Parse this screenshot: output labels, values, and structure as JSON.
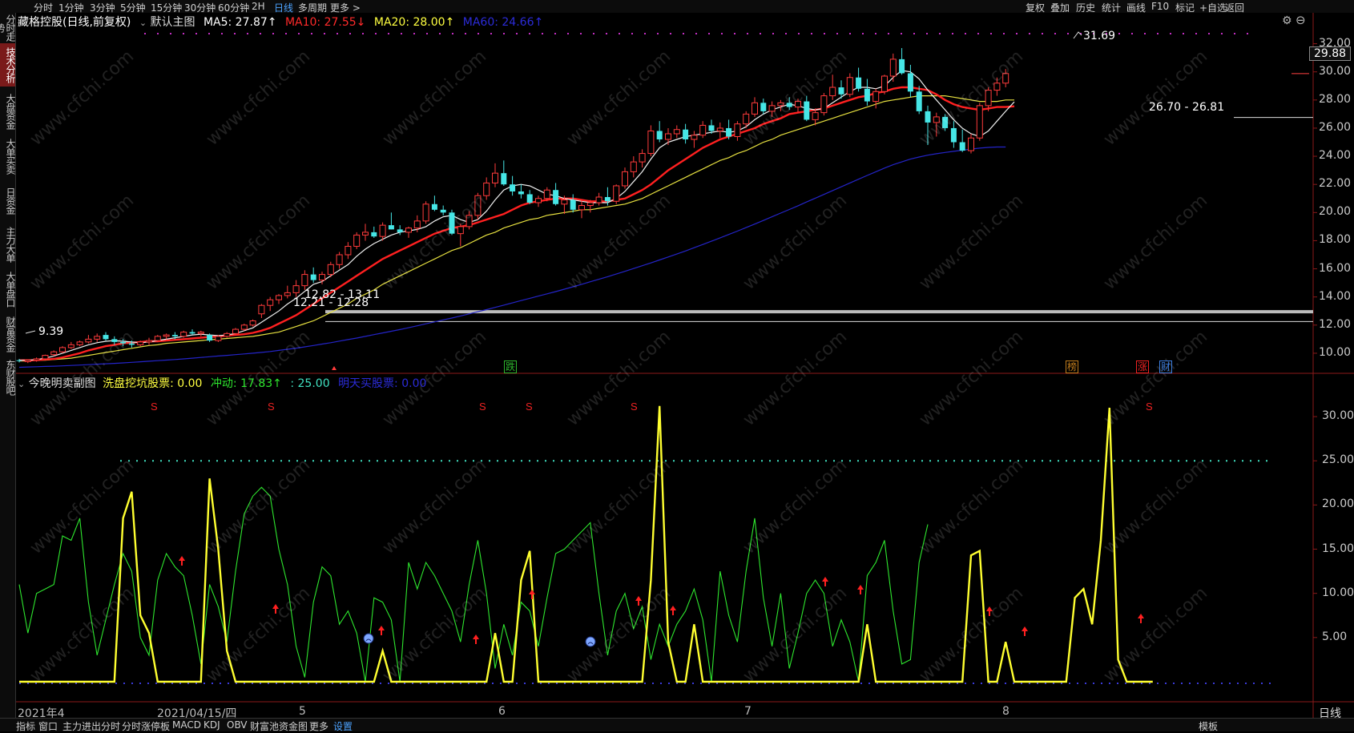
{
  "topbar": {
    "timeframes": [
      "分时",
      "1分钟",
      "3分钟",
      "5分钟",
      "15分钟",
      "30分钟",
      "60分钟",
      "2H",
      "日线",
      "多周期",
      "更多 >"
    ],
    "active_timeframe": "日线",
    "right_tools": [
      "复权",
      "叠加",
      "历史",
      "统计",
      "画线",
      "F10",
      "标记",
      "+自选",
      "返回"
    ]
  },
  "sidebar": {
    "items": [
      "分时走势",
      "技术分析",
      "大盘资金",
      "大单买卖",
      "日资金",
      "主力大单",
      "大单盘口",
      "财富资金",
      "东财股吧"
    ],
    "active": "技术分析"
  },
  "main_legend": {
    "title": "藏格控股(日线,前复权)",
    "indicator": "默认主图",
    "ma5": "MA5: 27.87↑",
    "ma10": "MA10: 27.55↓",
    "ma20": "MA20: 28.00↑",
    "ma60": "MA60: 24.66↑"
  },
  "sub_legend": {
    "title": "今晚明卖副图",
    "a": "洗盘挖坑股票: 0.00",
    "b": "冲动: 17.83↑",
    "c": ": 25.00",
    "d": "明天买股票: 0.00"
  },
  "price_axis": [
    "32.00",
    "30.00",
    "28.00",
    "26.00",
    "24.00",
    "22.00",
    "20.00",
    "18.00",
    "16.00",
    "14.00",
    "12.00",
    "10.00"
  ],
  "sub_axis": [
    "30.00",
    "25.00",
    "20.00",
    "15.00",
    "10.00",
    "5.00"
  ],
  "current_price": "29.88",
  "annotations": {
    "high": "31.69",
    "range_right": "26.70 - 26.81",
    "range_mid": "12.82 - 13.11",
    "range_low": "12.21 - 12.28",
    "low": "9.39"
  },
  "event_tags": [
    {
      "text": "跌",
      "color": "#2db52d"
    },
    {
      "text": "榜",
      "color": "#c07c1c"
    },
    {
      "text": "涨",
      "color": "#e22"
    },
    {
      "text": "财",
      "color": "#3c7ee0"
    }
  ],
  "x_axis": [
    "2021年4",
    "2021/04/15/四",
    "5",
    "6",
    "7",
    "8"
  ],
  "sub_axis_right": "日线",
  "bottombar": {
    "tabs": [
      "指标",
      "窗口",
      "主力进出分时",
      "分时涨停板",
      "MACD",
      "KDJ",
      "OBV",
      "财富池资金图",
      "更多",
      "设置"
    ],
    "active": "设置",
    "right": "模板"
  },
  "watermark": "www.cfchi.com",
  "chart_data": {
    "type": "line",
    "price_ylim": [
      8.8,
      33.4
    ],
    "sub_ylim": [
      -1,
      32
    ],
    "candles_ohlc": [
      [
        9.5,
        9.6,
        9.35,
        9.45
      ],
      [
        9.4,
        9.55,
        9.3,
        9.5
      ],
      [
        9.5,
        9.7,
        9.4,
        9.6
      ],
      [
        9.6,
        9.9,
        9.5,
        9.85
      ],
      [
        9.9,
        10.2,
        9.8,
        10.1
      ],
      [
        10.1,
        10.5,
        10.0,
        10.4
      ],
      [
        10.4,
        10.8,
        10.3,
        10.6
      ],
      [
        10.6,
        10.9,
        10.5,
        10.8
      ],
      [
        10.8,
        11.3,
        10.7,
        11.0
      ],
      [
        11.0,
        11.4,
        10.8,
        11.2
      ],
      [
        11.3,
        11.5,
        10.9,
        11.0
      ],
      [
        11.0,
        11.2,
        10.6,
        10.8
      ],
      [
        10.8,
        11.0,
        10.5,
        10.7
      ],
      [
        10.7,
        10.9,
        10.4,
        10.6
      ],
      [
        10.6,
        10.9,
        10.5,
        10.8
      ],
      [
        10.8,
        11.1,
        10.6,
        10.9
      ],
      [
        10.9,
        11.3,
        10.8,
        11.2
      ],
      [
        11.2,
        11.4,
        11.0,
        11.3
      ],
      [
        11.3,
        11.5,
        11.0,
        11.2
      ],
      [
        11.2,
        11.6,
        11.1,
        11.5
      ],
      [
        11.5,
        11.7,
        11.3,
        11.4
      ],
      [
        11.4,
        11.6,
        11.2,
        11.5
      ],
      [
        11.3,
        11.4,
        10.8,
        10.9
      ],
      [
        10.9,
        11.3,
        10.8,
        11.2
      ],
      [
        11.2,
        11.5,
        11.1,
        11.4
      ],
      [
        11.4,
        11.8,
        11.3,
        11.7
      ],
      [
        11.7,
        12.1,
        11.6,
        12.0
      ],
      [
        12.0,
        12.4,
        11.9,
        12.3
      ],
      [
        12.8,
        13.5,
        12.5,
        13.4
      ],
      [
        13.4,
        14.0,
        13.0,
        13.8
      ],
      [
        13.8,
        14.2,
        13.5,
        14.1
      ],
      [
        14.1,
        14.8,
        13.9,
        14.3
      ],
      [
        14.3,
        15.2,
        14.0,
        14.8
      ],
      [
        14.8,
        15.9,
        14.5,
        15.6
      ],
      [
        15.6,
        16.1,
        15.0,
        15.2
      ],
      [
        15.2,
        15.8,
        14.9,
        15.6
      ],
      [
        15.6,
        16.5,
        15.4,
        16.3
      ],
      [
        16.3,
        17.2,
        16.0,
        17.0
      ],
      [
        17.0,
        17.9,
        16.7,
        17.6
      ],
      [
        17.6,
        18.6,
        17.4,
        18.4
      ],
      [
        18.4,
        19.2,
        18.0,
        18.6
      ],
      [
        18.6,
        19.0,
        18.2,
        18.3
      ],
      [
        18.3,
        19.3,
        18.0,
        19.1
      ],
      [
        19.1,
        20.0,
        18.8,
        18.8
      ],
      [
        18.8,
        19.1,
        18.4,
        18.6
      ],
      [
        18.6,
        19.0,
        18.2,
        18.9
      ],
      [
        18.9,
        19.8,
        18.6,
        19.4
      ],
      [
        19.4,
        20.8,
        19.2,
        20.6
      ],
      [
        20.6,
        21.2,
        20.1,
        20.2
      ],
      [
        20.2,
        20.5,
        19.8,
        20.0
      ],
      [
        20.0,
        20.2,
        18.4,
        18.5
      ],
      [
        18.5,
        19.2,
        17.6,
        19.0
      ],
      [
        19.0,
        20.1,
        18.8,
        19.8
      ],
      [
        19.8,
        21.4,
        19.5,
        21.2
      ],
      [
        21.2,
        22.5,
        20.9,
        22.1
      ],
      [
        22.1,
        23.5,
        21.8,
        22.8
      ],
      [
        22.8,
        23.7,
        21.9,
        22.0
      ],
      [
        22.0,
        22.6,
        21.2,
        21.5
      ],
      [
        21.5,
        22.0,
        21.0,
        21.3
      ],
      [
        21.3,
        21.6,
        20.6,
        20.7
      ],
      [
        20.7,
        21.2,
        20.4,
        21.0
      ],
      [
        21.0,
        21.8,
        20.8,
        21.6
      ],
      [
        21.6,
        22.1,
        20.5,
        20.6
      ],
      [
        20.6,
        21.2,
        19.9,
        20.9
      ],
      [
        20.9,
        21.3,
        20.0,
        20.2
      ],
      [
        20.2,
        20.9,
        19.6,
        20.5
      ],
      [
        20.5,
        20.9,
        20.0,
        20.7
      ],
      [
        20.7,
        21.4,
        20.5,
        21.1
      ],
      [
        21.1,
        21.8,
        20.5,
        20.8
      ],
      [
        20.8,
        22.0,
        20.6,
        21.9
      ],
      [
        21.9,
        23.2,
        21.7,
        22.9
      ],
      [
        22.9,
        24.0,
        22.5,
        23.6
      ],
      [
        23.6,
        24.5,
        23.2,
        24.2
      ],
      [
        24.2,
        26.2,
        24.0,
        25.8
      ],
      [
        25.8,
        26.5,
        25.0,
        25.2
      ],
      [
        25.2,
        26.0,
        24.8,
        25.6
      ],
      [
        25.6,
        26.2,
        25.3,
        25.9
      ],
      [
        25.9,
        26.3,
        24.9,
        25.2
      ],
      [
        25.2,
        25.8,
        24.6,
        25.5
      ],
      [
        25.5,
        26.5,
        25.3,
        26.2
      ],
      [
        26.2,
        26.6,
        25.6,
        25.8
      ],
      [
        25.8,
        26.4,
        25.3,
        26.0
      ],
      [
        26.0,
        26.6,
        25.2,
        25.4
      ],
      [
        25.4,
        26.5,
        25.1,
        26.3
      ],
      [
        26.3,
        27.2,
        26.0,
        27.0
      ],
      [
        27.0,
        28.2,
        26.8,
        27.8
      ],
      [
        27.8,
        28.1,
        27.0,
        27.2
      ],
      [
        27.2,
        27.9,
        26.8,
        27.6
      ],
      [
        27.6,
        28.0,
        27.2,
        27.8
      ],
      [
        27.8,
        28.2,
        27.3,
        27.5
      ],
      [
        27.5,
        28.1,
        27.1,
        27.9
      ],
      [
        27.9,
        28.3,
        26.5,
        26.6
      ],
      [
        26.6,
        27.4,
        26.2,
        27.1
      ],
      [
        27.1,
        28.5,
        26.9,
        28.3
      ],
      [
        28.3,
        29.8,
        28.0,
        28.9
      ],
      [
        28.9,
        29.4,
        28.1,
        28.4
      ],
      [
        28.4,
        29.9,
        28.2,
        29.6
      ],
      [
        29.6,
        30.3,
        28.6,
        28.8
      ],
      [
        28.8,
        29.5,
        27.6,
        27.9
      ],
      [
        27.9,
        28.8,
        27.4,
        28.6
      ],
      [
        28.6,
        29.8,
        28.4,
        29.7
      ],
      [
        29.7,
        31.3,
        29.3,
        30.9
      ],
      [
        30.9,
        31.69,
        29.8,
        29.9
      ],
      [
        29.9,
        30.5,
        28.2,
        28.6
      ],
      [
        28.6,
        29.0,
        27.0,
        27.2
      ],
      [
        27.2,
        27.6,
        24.8,
        26.4
      ],
      [
        26.4,
        27.1,
        25.4,
        26.8
      ],
      [
        26.8,
        27.0,
        25.8,
        26.0
      ],
      [
        26.0,
        26.5,
        24.6,
        25.0
      ],
      [
        25.0,
        25.9,
        24.3,
        24.4
      ],
      [
        24.4,
        25.6,
        24.2,
        25.3
      ],
      [
        25.3,
        27.8,
        25.1,
        27.6
      ],
      [
        27.6,
        28.9,
        27.2,
        28.7
      ],
      [
        28.7,
        29.6,
        28.3,
        29.2
      ],
      [
        29.2,
        30.2,
        28.9,
        29.88
      ]
    ],
    "yellow_series": [
      0,
      0,
      0,
      0,
      0,
      0,
      0,
      0,
      0,
      0,
      0,
      0,
      18.5,
      21.5,
      7.5,
      5.5,
      0,
      0,
      0,
      0,
      0,
      0,
      23,
      15,
      3.5,
      0,
      0,
      0,
      0,
      0,
      0,
      0,
      0,
      0,
      0,
      0,
      0,
      0,
      0,
      0,
      0,
      0,
      3.5,
      0,
      0,
      0,
      0,
      0,
      0,
      0,
      0,
      0,
      0,
      0,
      0,
      5.5,
      0,
      0,
      11.5,
      14.8,
      0,
      0,
      0,
      0,
      0,
      0,
      0,
      0,
      0,
      0,
      0,
      0,
      0,
      11.5,
      31.2,
      4.5,
      0,
      0,
      6.5,
      0,
      0,
      0,
      0,
      0,
      0,
      0,
      0,
      0,
      0,
      0,
      0,
      0,
      0,
      0,
      0,
      0,
      0,
      0,
      6.5,
      0,
      0,
      0,
      0,
      0,
      0,
      0,
      0,
      0,
      0,
      0,
      14.3,
      14.8,
      0,
      0,
      4.5,
      0,
      0,
      0,
      0,
      0,
      0,
      0,
      9.5,
      10.5,
      6.5,
      16,
      31,
      2.5,
      0,
      0,
      0,
      0
    ],
    "green_series": [
      11,
      5.5,
      10,
      10.5,
      11,
      16.5,
      16,
      18.5,
      9,
      3,
      7,
      11,
      14.5,
      12.5,
      5,
      3,
      11.5,
      14.5,
      13,
      12,
      7.5,
      2,
      11,
      8.5,
      4.5,
      12.5,
      19,
      21,
      22,
      21,
      15,
      11,
      4,
      0.5,
      9,
      13,
      12,
      6.5,
      8,
      5.5,
      0,
      9.5,
      9,
      7,
      0,
      13.5,
      10.5,
      13.5,
      12,
      10,
      8,
      4.5,
      11,
      16,
      10,
      1.5,
      6.5,
      3,
      9,
      8,
      4,
      9.5,
      14.5,
      15,
      16,
      17,
      18,
      10,
      3,
      8,
      10,
      6,
      8.5,
      2.5,
      6.5,
      4,
      6.5,
      8,
      10.5,
      7,
      0,
      12.5,
      7.5,
      4.5,
      12.5,
      18.5,
      9.5,
      4,
      10,
      1.5,
      5.5,
      10,
      11.5,
      10,
      4,
      7,
      4.5,
      0,
      12,
      13.5,
      16,
      8,
      2,
      2.5,
      13.5,
      17.8
    ],
    "ma5": [
      9.5,
      9.5,
      9.55,
      9.65,
      9.8,
      10.0,
      10.2,
      10.4,
      10.6,
      10.75,
      10.85,
      10.9,
      10.85,
      10.8,
      10.75,
      10.8,
      10.9,
      11.0,
      11.1,
      11.2,
      11.3,
      11.35,
      11.3,
      11.25,
      11.3,
      11.4,
      11.6,
      11.8,
      12.2,
      12.6,
      13.0,
      13.5,
      13.9,
      14.4,
      14.9,
      15.1,
      15.5,
      15.9,
      16.3,
      16.9,
      17.4,
      17.8,
      18.1,
      18.4,
      18.6,
      18.7,
      18.8,
      19.0,
      19.4,
      19.7,
      19.8,
      19.5,
      19.3,
      19.5,
      20.1,
      20.9,
      21.6,
      21.9,
      22.0,
      21.9,
      21.6,
      21.3,
      21.2,
      21.0,
      20.9,
      20.8,
      20.7,
      20.7,
      20.7,
      21.0,
      21.5,
      22.2,
      22.9,
      23.8,
      24.6,
      25.0,
      25.2,
      25.4,
      25.5,
      25.6,
      25.7,
      25.8,
      25.7,
      25.8,
      26.1,
      26.6,
      27.0,
      27.3,
      27.5,
      27.7,
      27.6,
      27.4,
      27.3,
      27.4,
      27.8,
      28.2,
      28.6,
      28.9,
      28.9,
      28.8,
      29.0,
      29.6,
      30.1,
      30.0,
      29.5,
      28.7,
      28.0,
      27.3,
      26.6,
      26.0,
      25.6,
      25.4,
      25.8,
      26.5,
      27.2,
      27.87
    ],
    "ma10": [
      9.5,
      9.5,
      9.5,
      9.55,
      9.6,
      9.7,
      9.85,
      10.0,
      10.2,
      10.35,
      10.5,
      10.6,
      10.7,
      10.75,
      10.8,
      10.85,
      10.85,
      10.9,
      10.95,
      11.0,
      11.05,
      11.1,
      11.15,
      11.2,
      11.25,
      11.3,
      11.35,
      11.45,
      11.6,
      11.8,
      12.1,
      12.4,
      12.7,
      13.1,
      13.5,
      13.9,
      14.3,
      14.7,
      15.1,
      15.5,
      15.9,
      16.3,
      16.7,
      17.0,
      17.3,
      17.6,
      17.9,
      18.2,
      18.5,
      18.7,
      18.9,
      19.0,
      19.1,
      19.3,
      19.5,
      19.7,
      19.9,
      20.2,
      20.5,
      20.7,
      20.8,
      20.9,
      21.0,
      21.0,
      21.0,
      20.9,
      20.8,
      20.8,
      20.8,
      20.9,
      21.0,
      21.3,
      21.6,
      22.0,
      22.5,
      23.0,
      23.4,
      23.8,
      24.2,
      24.6,
      24.9,
      25.2,
      25.4,
      25.6,
      25.8,
      26.0,
      26.3,
      26.5,
      26.7,
      27.0,
      27.1,
      27.2,
      27.3,
      27.4,
      27.6,
      27.8,
      28.0,
      28.2,
      28.3,
      28.5,
      28.6,
      28.8,
      28.9,
      28.9,
      28.8,
      28.7,
      28.4,
      28.0,
      27.7,
      27.5,
      27.4,
      27.3,
      27.4,
      27.5,
      27.5,
      27.55
    ],
    "ma20": [
      9.45,
      9.45,
      9.5,
      9.5,
      9.55,
      9.6,
      9.65,
      9.75,
      9.85,
      9.95,
      10.05,
      10.15,
      10.25,
      10.35,
      10.45,
      10.55,
      10.6,
      10.7,
      10.75,
      10.8,
      10.85,
      10.9,
      10.95,
      11.0,
      11.05,
      11.1,
      11.15,
      11.2,
      11.3,
      11.4,
      11.5,
      11.7,
      11.9,
      12.1,
      12.3,
      12.6,
      12.9,
      13.2,
      13.5,
      13.9,
      14.2,
      14.5,
      14.9,
      15.2,
      15.5,
      15.8,
      16.1,
      16.4,
      16.7,
      17.0,
      17.3,
      17.5,
      17.8,
      18.1,
      18.4,
      18.6,
      18.9,
      19.1,
      19.3,
      19.5,
      19.6,
      19.8,
      19.9,
      20.0,
      20.1,
      20.2,
      20.2,
      20.3,
      20.4,
      20.5,
      20.6,
      20.8,
      21.0,
      21.3,
      21.6,
      21.9,
      22.2,
      22.5,
      22.8,
      23.1,
      23.4,
      23.7,
      23.9,
      24.2,
      24.4,
      24.7,
      25.0,
      25.2,
      25.5,
      25.7,
      25.9,
      26.1,
      26.3,
      26.5,
      26.7,
      26.9,
      27.1,
      27.3,
      27.5,
      27.7,
      27.9,
      28.0,
      28.1,
      28.2,
      28.3,
      28.3,
      28.3,
      28.3,
      28.2,
      28.1,
      28.0,
      27.9,
      27.9,
      27.9,
      28.0,
      28.0
    ],
    "ma60": [
      9.0,
      9.02,
      9.04,
      9.06,
      9.08,
      9.1,
      9.13,
      9.16,
      9.19,
      9.22,
      9.25,
      9.28,
      9.31,
      9.35,
      9.39,
      9.43,
      9.47,
      9.51,
      9.55,
      9.6,
      9.65,
      9.7,
      9.75,
      9.8,
      9.85,
      9.9,
      9.95,
      10.0,
      10.06,
      10.12,
      10.2,
      10.28,
      10.36,
      10.45,
      10.55,
      10.65,
      10.75,
      10.86,
      10.97,
      11.08,
      11.2,
      11.32,
      11.44,
      11.56,
      11.68,
      11.81,
      11.95,
      12.09,
      12.23,
      12.37,
      12.5,
      12.65,
      12.8,
      12.95,
      13.1,
      13.26,
      13.42,
      13.58,
      13.74,
      13.9,
      14.06,
      14.22,
      14.38,
      14.55,
      14.72,
      14.9,
      15.08,
      15.26,
      15.44,
      15.63,
      15.82,
      16.02,
      16.22,
      16.42,
      16.63,
      16.84,
      17.05,
      17.27,
      17.5,
      17.73,
      17.96,
      18.2,
      18.44,
      18.68,
      18.93,
      19.18,
      19.44,
      19.7,
      19.96,
      20.22,
      20.48,
      20.75,
      21.02,
      21.29,
      21.56,
      21.83,
      22.1,
      22.37,
      22.64,
      22.9,
      23.16,
      23.4,
      23.6,
      23.8,
      23.95,
      24.08,
      24.18,
      24.27,
      24.35,
      24.43,
      24.51,
      24.58,
      24.63,
      24.66,
      24.66
    ]
  }
}
